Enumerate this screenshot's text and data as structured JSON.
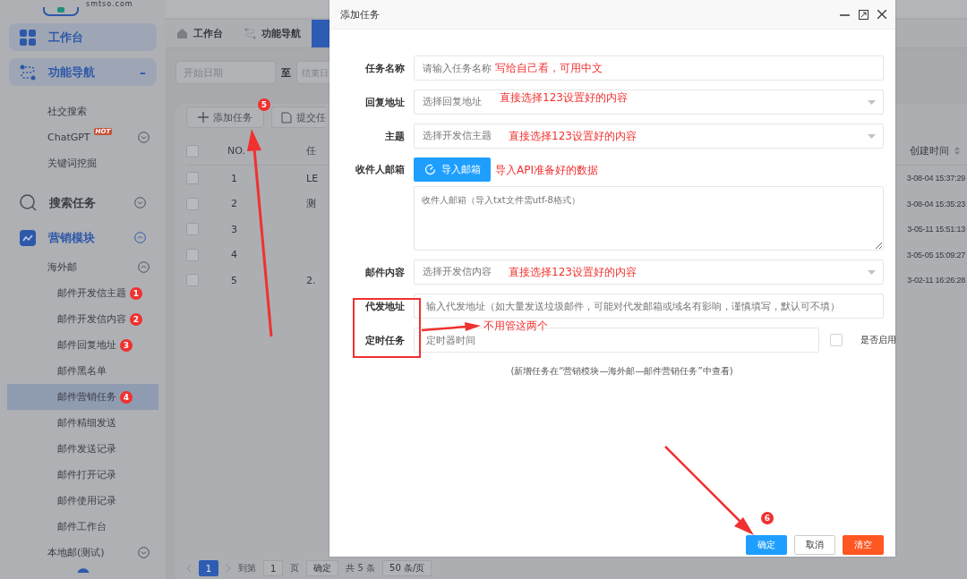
{
  "sidebar": {
    "logo_text": "smtso.com",
    "items": [
      {
        "kind": "group",
        "label": "工作台"
      },
      {
        "kind": "group",
        "label": "功能导航",
        "expanded": true,
        "toggle_text": "–",
        "children": [
          {
            "kind": "item",
            "label": "社交搜索",
            "selected": false
          },
          {
            "kind": "item",
            "label": "ChatGPT",
            "badge": "HOT",
            "expanded": false,
            "selected": false
          },
          {
            "kind": "item",
            "label": "关键词挖掘",
            "selected": false
          }
        ]
      },
      {
        "kind": "group",
        "label": "搜索任务",
        "expanded": false
      },
      {
        "kind": "group",
        "label": "营销模块",
        "expanded": true,
        "children": [
          {
            "kind": "item",
            "label": "海外邮",
            "expanded": true,
            "selected": false,
            "children": [
              {
                "kind": "leaf",
                "label": "邮件开发信主题",
                "step": "1",
                "selected": false
              },
              {
                "kind": "leaf",
                "label": "邮件开发信内容",
                "step": "2",
                "selected": false
              },
              {
                "kind": "leaf",
                "label": "邮件回复地址",
                "step": "3",
                "selected": false
              },
              {
                "kind": "leaf",
                "label": "邮件黑名单",
                "selected": false
              },
              {
                "kind": "leaf",
                "label": "邮件营销任务",
                "step": "4",
                "selected": true
              },
              {
                "kind": "leaf",
                "label": "邮件精细发送",
                "selected": false
              },
              {
                "kind": "leaf",
                "label": "邮件发送记录",
                "selected": false
              },
              {
                "kind": "leaf",
                "label": "邮件打开记录",
                "selected": false
              },
              {
                "kind": "leaf",
                "label": "邮件使用记录",
                "selected": false
              },
              {
                "kind": "leaf",
                "label": "邮件工作台",
                "selected": false
              }
            ]
          },
          {
            "kind": "item",
            "label": "本地邮(测试)",
            "expanded": false,
            "selected": false
          }
        ]
      }
    ]
  },
  "tabs": [
    {
      "label": "工作台",
      "selected": false
    },
    {
      "label": "功能导航",
      "selected": false
    },
    {
      "selected": true
    }
  ],
  "filters": {
    "start_placeholder": "开始日期",
    "separator": "至",
    "end_placeholder": "结束日"
  },
  "toolbar": {
    "add_button": "添加任务",
    "add_step": "5",
    "submit_button": "提交任"
  },
  "table": {
    "all_checked": false,
    "columns": [
      "NO.",
      "任",
      "创建时间"
    ],
    "rows": [
      {
        "no": "1",
        "task": "LE",
        "created": "3-08-04 15:37:29",
        "checked": false
      },
      {
        "no": "2",
        "task": "测",
        "created": "3-08-04 15:35:23",
        "checked": false
      },
      {
        "no": "3",
        "created": "3-05-11 15:51:13",
        "checked": false
      },
      {
        "no": "4",
        "created": "3-05-05 15:09:27",
        "checked": false
      },
      {
        "no": "5",
        "task": "2.",
        "created": "3-02-11 16:26:28",
        "checked": false
      }
    ]
  },
  "pagination": {
    "current": "1",
    "goto_label": "到第",
    "goto_value": "1",
    "page_unit": "页",
    "goto_button": "确定",
    "total": "共 5 条",
    "page_size": "50 条/页"
  },
  "dialog": {
    "title": "添加任务",
    "fields": [
      {
        "kind": "text",
        "label": "任务名称",
        "placeholder": "请输入任务名称",
        "note": "写给自己看，可用中文"
      },
      {
        "kind": "select",
        "label": "回复地址",
        "placeholder": "选择回复地址",
        "note": "直接选择123设置好的内容"
      },
      {
        "kind": "select",
        "label": "主题",
        "placeholder": "选择开发信主题",
        "note": "直接选择123设置好的内容"
      },
      {
        "kind": "import",
        "label": "收件人邮箱",
        "button": "导入邮箱",
        "note": "导入API准备好的数据",
        "textarea_placeholder": "收件人邮箱（导入txt文件需utf-8格式）"
      },
      {
        "kind": "select",
        "label": "邮件内容",
        "placeholder": "选择开发信内容",
        "note": "直接选择123设置好的内容"
      },
      {
        "kind": "text",
        "label": "代发地址",
        "placeholder": "输入代发地址（如大量发送垃圾邮件，可能对代发邮箱或域名有影响，谨慎填写，默认可不填）"
      },
      {
        "kind": "timer",
        "label": "定时任务",
        "placeholder": "定时器时间",
        "checkbox_label": "是否启用",
        "checked": false
      }
    ],
    "hint": "(新增任务在“营销模块—海外邮—邮件营销任务”中查看)",
    "boxed_note": "不用管这两个",
    "buttons": [
      {
        "kind": "primary",
        "label": "确定",
        "step": "6"
      },
      {
        "kind": "default",
        "label": "取消"
      },
      {
        "kind": "danger",
        "label": "清空"
      }
    ]
  }
}
